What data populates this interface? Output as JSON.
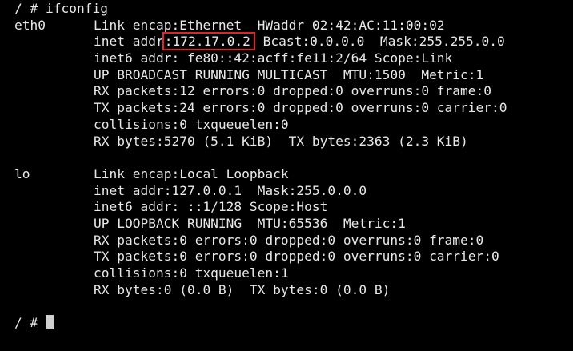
{
  "terminal": {
    "prompt": "/ #",
    "command": "ifconfig",
    "eth0": {
      "name": "eth0",
      "lines": [
        "Link encap:Ethernet  HWaddr 02:42:AC:11:00:02",
        "",
        "inet6 addr: fe80::42:acff:fe11:2/64 Scope:Link",
        "UP BROADCAST RUNNING MULTICAST  MTU:1500  Metric:1",
        "RX packets:12 errors:0 dropped:0 overruns:0 frame:0",
        "TX packets:24 errors:0 dropped:0 overruns:0 carrier:0",
        "collisions:0 txqueuelen:0",
        "RX bytes:5270 (5.1 KiB)  TX bytes:2363 (2.3 KiB)"
      ],
      "inet_prefix": "inet addr",
      "inet_addr": ":172.17.0.2",
      "inet_suffix": " Bcast:0.0.0.0  Mask:255.255.0.0"
    },
    "lo": {
      "name": "lo",
      "lines": [
        "Link encap:Local Loopback",
        "inet addr:127.0.0.1  Mask:255.0.0.0",
        "inet6 addr: ::1/128 Scope:Host",
        "UP LOOPBACK RUNNING  MTU:65536  Metric:1",
        "RX packets:0 errors:0 dropped:0 overruns:0 frame:0",
        "TX packets:0 errors:0 dropped:0 overruns:0 carrier:0",
        "collisions:0 txqueuelen:1",
        "RX bytes:0 (0.0 B)  TX bytes:0 (0.0 B)"
      ]
    },
    "highlight_color": "#e0232a"
  }
}
